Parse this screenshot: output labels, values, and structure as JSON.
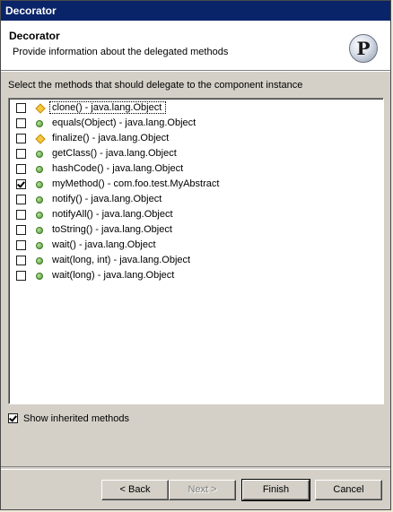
{
  "window": {
    "title": "Decorator"
  },
  "header": {
    "title": "Decorator",
    "description": "Provide information about the delegated methods",
    "logo_letter": "P"
  },
  "instruction": "Select the methods that should delegate to the component instance",
  "methods": [
    {
      "label": "clone() - java.lang.Object",
      "checked": false,
      "icon": "protected-diamond-icon"
    },
    {
      "label": "equals(Object) - java.lang.Object",
      "checked": false,
      "icon": "public-dot-icon"
    },
    {
      "label": "finalize() - java.lang.Object",
      "checked": false,
      "icon": "protected-diamond-icon"
    },
    {
      "label": "getClass() - java.lang.Object",
      "checked": false,
      "icon": "public-dot-icon"
    },
    {
      "label": "hashCode() - java.lang.Object",
      "checked": false,
      "icon": "public-dot-icon"
    },
    {
      "label": "myMethod() - com.foo.test.MyAbstract",
      "checked": true,
      "icon": "public-dot-icon"
    },
    {
      "label": "notify() - java.lang.Object",
      "checked": false,
      "icon": "public-dot-icon"
    },
    {
      "label": "notifyAll() - java.lang.Object",
      "checked": false,
      "icon": "public-dot-icon"
    },
    {
      "label": "toString() - java.lang.Object",
      "checked": false,
      "icon": "public-dot-icon"
    },
    {
      "label": "wait() - java.lang.Object",
      "checked": false,
      "icon": "public-dot-icon"
    },
    {
      "label": "wait(long, int) - java.lang.Object",
      "checked": false,
      "icon": "public-dot-icon"
    },
    {
      "label": "wait(long) - java.lang.Object",
      "checked": false,
      "icon": "public-dot-icon"
    }
  ],
  "show_inherited": {
    "label": "Show inherited methods",
    "checked": true
  },
  "buttons": {
    "back": "< Back",
    "next": "Next >",
    "finish": "Finish",
    "cancel": "Cancel"
  }
}
